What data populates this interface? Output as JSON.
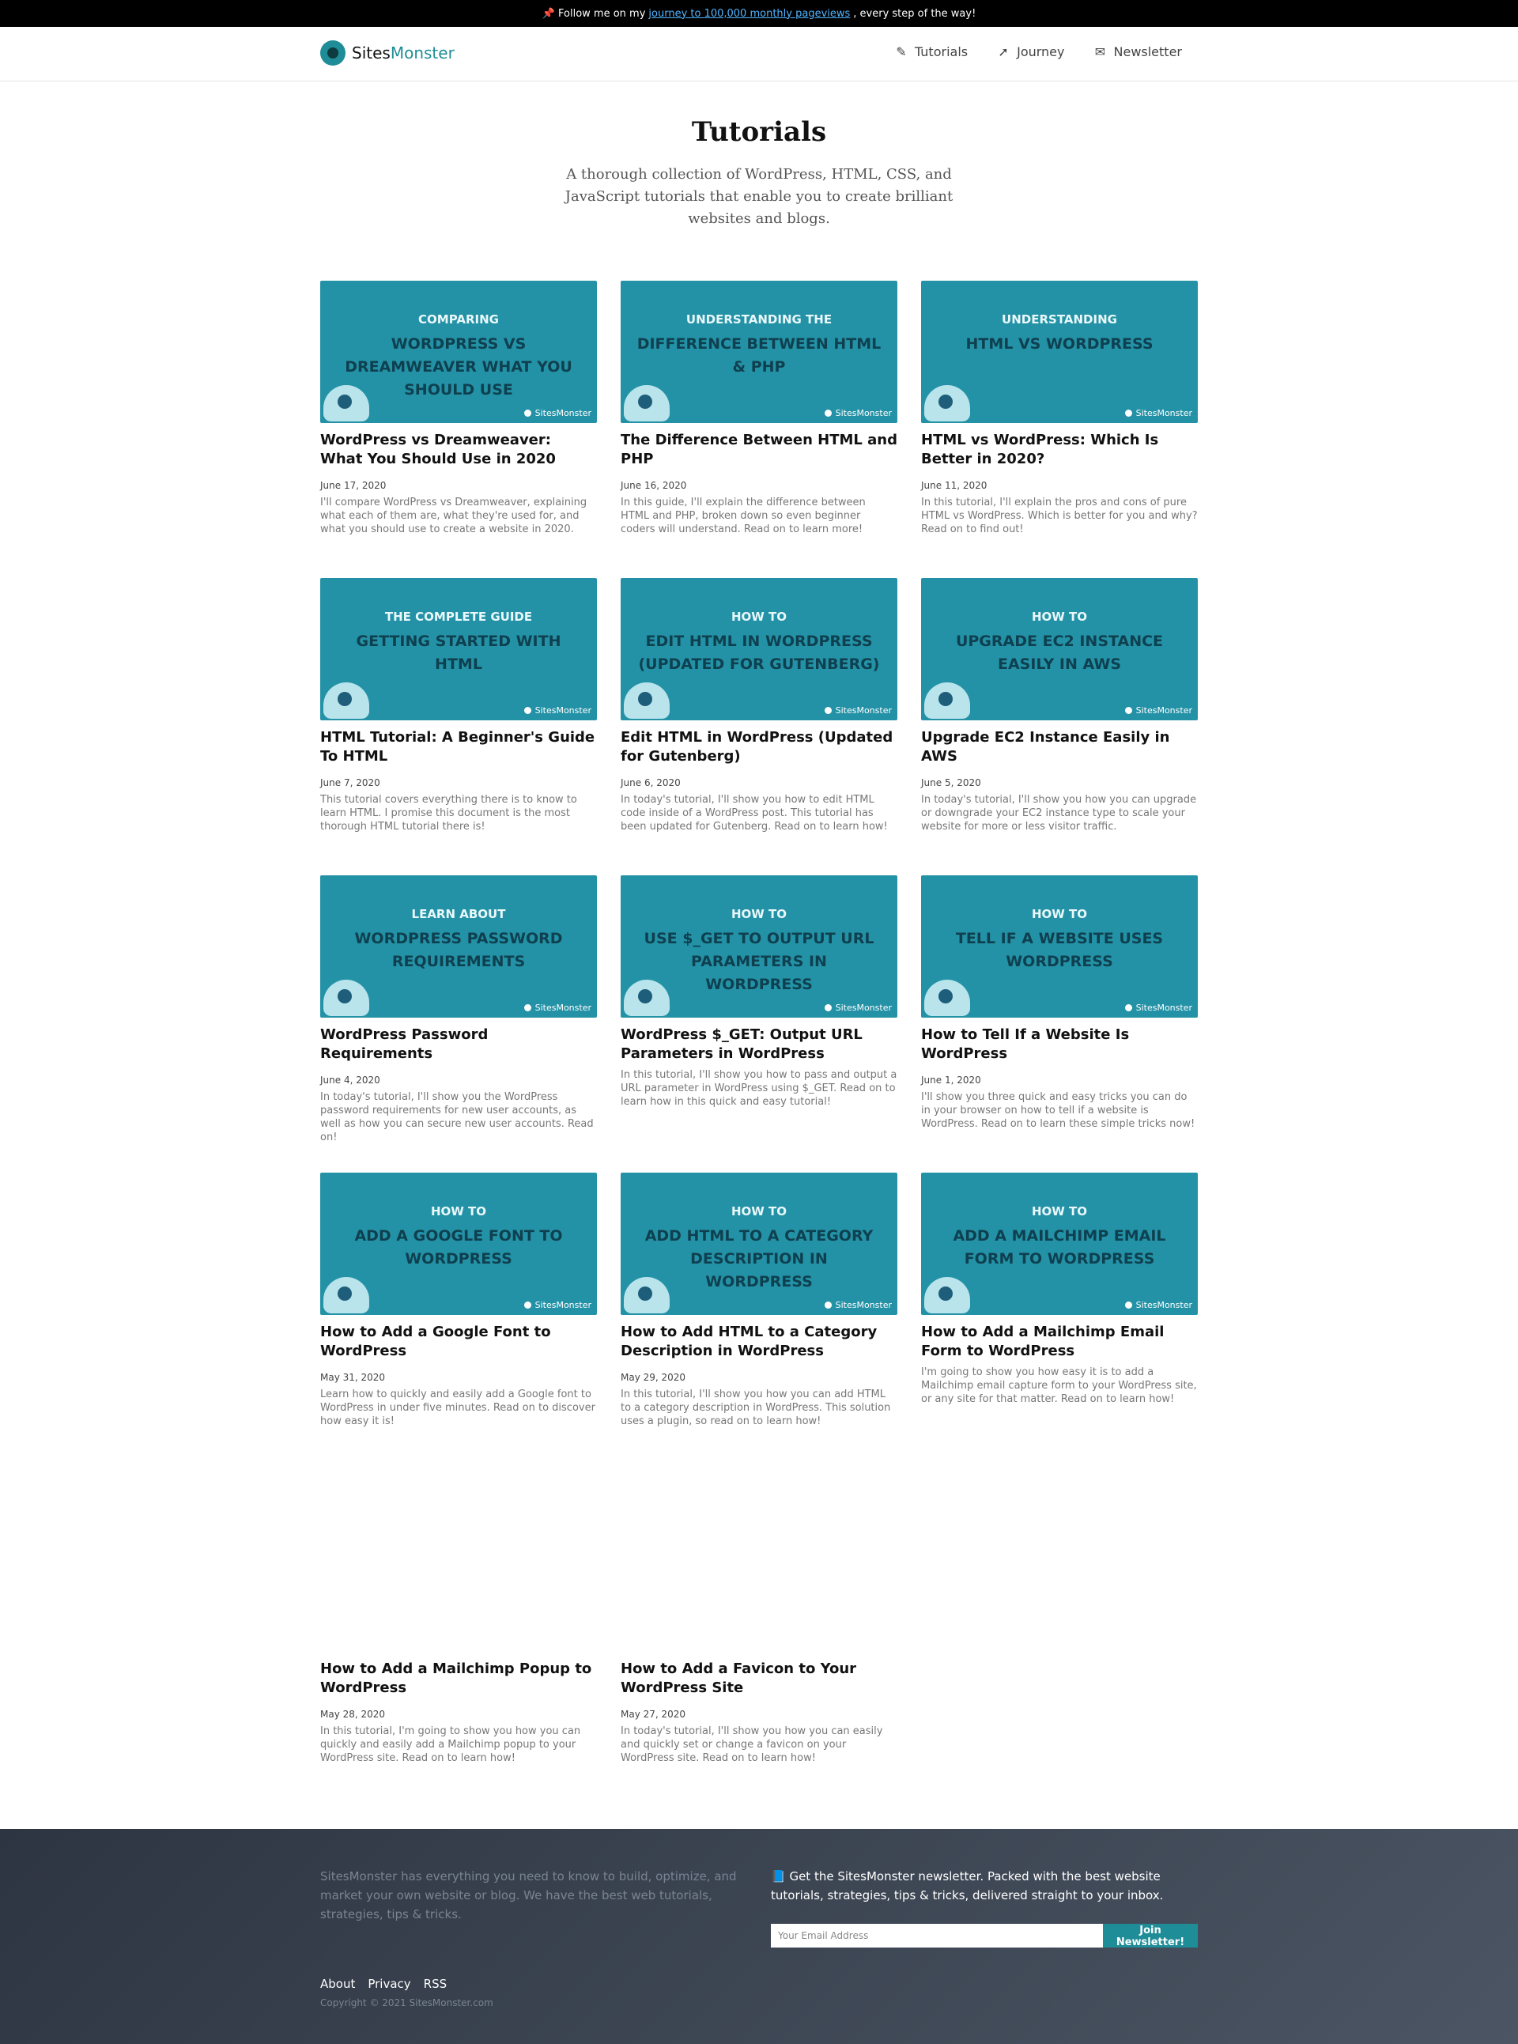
{
  "announcement": {
    "icon": "pushpin-icon",
    "before": "📌 Follow me on my",
    "link": "journey to 100,000 monthly pageviews",
    "after": ", every step of the way!"
  },
  "brand": {
    "prefix": "Sites",
    "suffix": "Monster",
    "accent_color": "#1e8d97"
  },
  "nav": {
    "items": [
      {
        "label": "Tutorials",
        "icon": "pencil-icon"
      },
      {
        "label": "Journey",
        "icon": "rocket-icon"
      },
      {
        "label": "Newsletter",
        "icon": "envelope-icon"
      }
    ]
  },
  "hero": {
    "title": "Tutorials",
    "subtitle": "A thorough collection of WordPress, HTML, CSS, and JavaScript tutorials that enable you to create brilliant websites and blogs."
  },
  "thumbnail_brand": "SitesMonster",
  "posts": [
    {
      "thumb_pre": "COMPARING",
      "thumb_main": "WORDPRESS VS DREAMWEAVER WHAT YOU SHOULD USE",
      "title": "WordPress vs Dreamweaver: What You Should Use in 2020",
      "date": "June 17, 2020",
      "excerpt": "I'll compare WordPress vs Dreamweaver, explaining what each of them are, what they're used for, and what you should use to create a website in 2020."
    },
    {
      "thumb_pre": "UNDERSTANDING THE",
      "thumb_main": "DIFFERENCE BETWEEN HTML & PHP",
      "title": "The Difference Between HTML and PHP",
      "date": "June 16, 2020",
      "excerpt": "In this guide, I'll explain the difference between HTML and PHP, broken down so even beginner coders will understand. Read on to learn more!"
    },
    {
      "thumb_pre": "UNDERSTANDING",
      "thumb_main": "HTML VS WORDPRESS",
      "title": "HTML vs WordPress: Which Is Better in 2020?",
      "date": "June 11, 2020",
      "excerpt": "In this tutorial, I'll explain the pros and cons of pure HTML vs WordPress. Which is better for you and why? Read on to find out!"
    },
    {
      "thumb_pre": "THE COMPLETE GUIDE",
      "thumb_main": "GETTING STARTED WITH HTML",
      "title": "HTML Tutorial: A Beginner's Guide To HTML",
      "date": "June 7, 2020",
      "excerpt": "This tutorial covers everything there is to know to learn HTML. I promise this document is the most thorough HTML tutorial there is!"
    },
    {
      "thumb_pre": "HOW TO",
      "thumb_main": "EDIT HTML IN WORDPRESS (UPDATED FOR GUTENBERG)",
      "title": "Edit HTML in WordPress (Updated for Gutenberg)",
      "date": "June 6, 2020",
      "excerpt": "In today's tutorial, I'll show you how to edit HTML code inside of a WordPress post. This tutorial has been updated for Gutenberg. Read on to learn how!"
    },
    {
      "thumb_pre": "HOW TO",
      "thumb_main": "UPGRADE EC2 INSTANCE EASILY IN AWS",
      "title": "Upgrade EC2 Instance Easily in AWS",
      "date": "June 5, 2020",
      "excerpt": "In today's tutorial, I'll show you how you can upgrade or downgrade your EC2 instance type to scale your website for more or less visitor traffic."
    },
    {
      "thumb_pre": "LEARN ABOUT",
      "thumb_main": "WORDPRESS PASSWORD REQUIREMENTS",
      "title": "WordPress Password Requirements",
      "date": "June 4, 2020",
      "excerpt": "In today's tutorial, I'll show you the WordPress password requirements for new user accounts, as well as how you can secure new user accounts. Read on!"
    },
    {
      "thumb_pre": "HOW TO",
      "thumb_main": "USE $_GET TO OUTPUT URL PARAMETERS IN WORDPRESS",
      "title": "WordPress $_GET: Output URL Parameters in WordPress",
      "date": "",
      "excerpt": "In this tutorial, I'll show you how to pass and output a URL parameter in WordPress using $_GET. Read on to learn how in this quick and easy tutorial!"
    },
    {
      "thumb_pre": "HOW TO",
      "thumb_main": "TELL IF A WEBSITE USES WORDPRESS",
      "title": "How to Tell If a Website Is WordPress",
      "date": "June 1, 2020",
      "excerpt": "I'll show you three quick and easy tricks you can do in your browser on how to tell if a website is WordPress. Read on to learn these simple tricks now!"
    },
    {
      "thumb_pre": "HOW TO",
      "thumb_main": "ADD A GOOGLE FONT TO WORDPRESS",
      "title": "How to Add a Google Font to WordPress",
      "date": "May 31, 2020",
      "excerpt": "Learn how to quickly and easily add a Google font to WordPress in under five minutes. Read on to discover how easy it is!"
    },
    {
      "thumb_pre": "HOW TO",
      "thumb_main": "ADD HTML TO A CATEGORY DESCRIPTION IN WORDPRESS",
      "title": "How to Add HTML to a Category Description in WordPress",
      "date": "May 29, 2020",
      "excerpt": "In this tutorial, I'll show you how you can add HTML to a category description in WordPress. This solution uses a plugin, so read on to learn how!"
    },
    {
      "thumb_pre": "HOW TO",
      "thumb_main": "ADD A MAILCHIMP EMAIL FORM TO WORDPRESS",
      "title": "How to Add a Mailchimp Email Form to WordPress",
      "date": "",
      "excerpt": "I'm going to show you how easy it is to add a Mailchimp email capture form to your WordPress site, or any site for that matter. Read on to learn how!"
    },
    {
      "thumb_pre": "",
      "thumb_main": "",
      "title": "How to Add a Mailchimp Popup to WordPress",
      "date": "May 28, 2020",
      "excerpt": "In this tutorial, I'm going to show you how you can quickly and easily add a Mailchimp popup to your WordPress site. Read on to learn how!"
    },
    {
      "thumb_pre": "",
      "thumb_main": "",
      "title": "How to Add a Favicon to Your WordPress Site",
      "date": "May 27, 2020",
      "excerpt": "In today's tutorial, I'll show you how you can easily and quickly set or change a favicon on your WordPress site. Read on to learn how!"
    }
  ],
  "footer": {
    "about": "SitesMonster has everything you need to know to build, optimize, and market your own website or blog. We have the best web tutorials, strategies, tips & tricks.",
    "newsletter": "📘 Get the SitesMonster newsletter. Packed with the best website tutorials, strategies, tips & tricks, delivered straight to your inbox.",
    "email_placeholder": "Your Email Address",
    "button": "Join Newsletter!",
    "links": [
      "About",
      "Privacy",
      "RSS"
    ],
    "copyright": "Copyright © 2021 SitesMonster.com"
  }
}
